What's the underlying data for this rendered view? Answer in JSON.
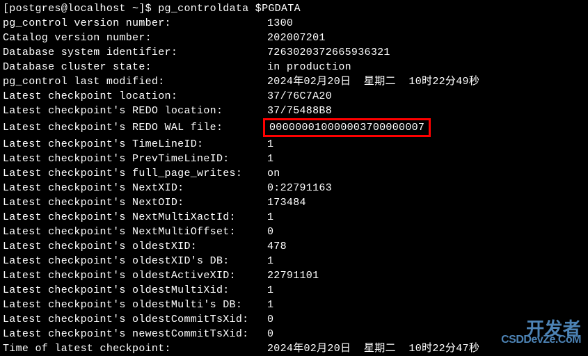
{
  "prompt": "[postgres@localhost ~]$ ",
  "command": "pg_controldata $PGDATA",
  "rows": [
    {
      "label": "pg_control version number:",
      "value": "1300"
    },
    {
      "label": "Catalog version number:",
      "value": "202007201"
    },
    {
      "label": "Database system identifier:",
      "value": "7263020372665936321"
    },
    {
      "label": "Database cluster state:",
      "value": "in production"
    },
    {
      "label": "pg_control last modified:",
      "value": "2024年02月20日  星期二  10时22分49秒"
    },
    {
      "label": "Latest checkpoint location:",
      "value": "37/76C7A20"
    },
    {
      "label": "Latest checkpoint's REDO location:",
      "value": "37/75488B8"
    },
    {
      "label": "Latest checkpoint's REDO WAL file:",
      "value": "000000010000003700000007",
      "highlight": true
    },
    {
      "label": "Latest checkpoint's TimeLineID:",
      "value": "1"
    },
    {
      "label": "Latest checkpoint's PrevTimeLineID:",
      "value": "1"
    },
    {
      "label": "Latest checkpoint's full_page_writes:",
      "value": "on"
    },
    {
      "label": "Latest checkpoint's NextXID:",
      "value": "0:22791163"
    },
    {
      "label": "Latest checkpoint's NextOID:",
      "value": "173484"
    },
    {
      "label": "Latest checkpoint's NextMultiXactId:",
      "value": "1"
    },
    {
      "label": "Latest checkpoint's NextMultiOffset:",
      "value": "0"
    },
    {
      "label": "Latest checkpoint's oldestXID:",
      "value": "478"
    },
    {
      "label": "Latest checkpoint's oldestXID's DB:",
      "value": "1"
    },
    {
      "label": "Latest checkpoint's oldestActiveXID:",
      "value": "22791101"
    },
    {
      "label": "Latest checkpoint's oldestMultiXid:",
      "value": "1"
    },
    {
      "label": "Latest checkpoint's oldestMulti's DB:",
      "value": "1"
    },
    {
      "label": "Latest checkpoint's oldestCommitTsXid:",
      "value": "0"
    },
    {
      "label": "Latest checkpoint's newestCommitTsXid:",
      "value": "0"
    },
    {
      "label": "Time of latest checkpoint:",
      "value": "2024年02月20日  星期二  10时22分47秒"
    }
  ],
  "watermark": {
    "top": "开发者",
    "bottom": "CSDDevZe.CoM"
  }
}
